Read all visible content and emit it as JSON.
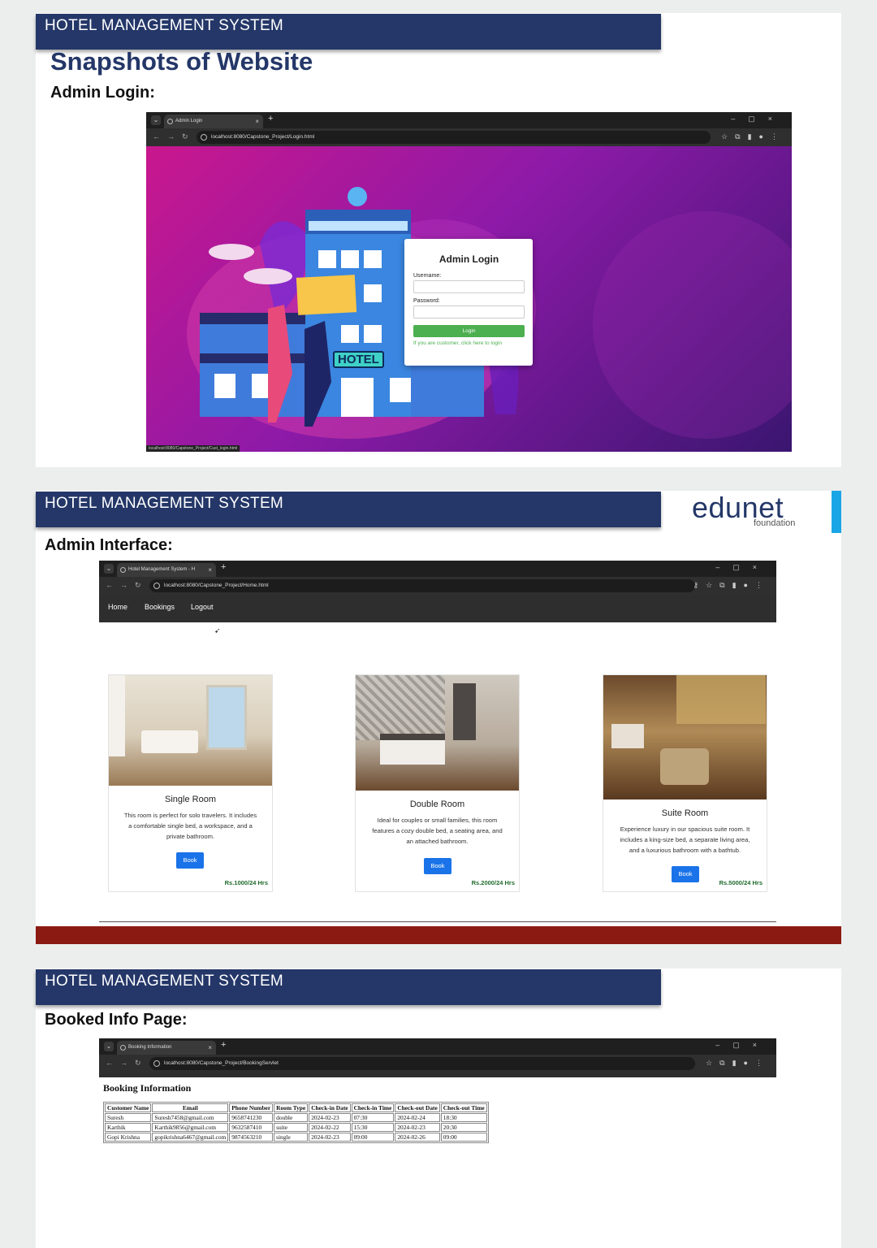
{
  "slide1": {
    "banner": "HOTEL MANAGEMENT SYSTEM",
    "title": "Snapshots of Website",
    "subtitle": "Admin Login:",
    "browser": {
      "tab_title": "Admin Login",
      "url": "localhost:8080/Capstone_Project/Login.html",
      "status_url": "localhost:8080/Capstone_Project/Cust_login.html"
    },
    "hotel_sign": "HOTEL",
    "login": {
      "title": "Admin Login",
      "username_label": "Username:",
      "password_label": "Password:",
      "button": "Login",
      "customer_link": "If you are customer, click here to login"
    }
  },
  "slide2": {
    "banner": "HOTEL MANAGEMENT SYSTEM",
    "logo_main": "edunet",
    "logo_sub": "foundation",
    "subtitle": "Admin Interface:",
    "browser": {
      "tab_title": "Hotel Management System - H",
      "url": "localhost:8080/Capstone_Project/Home.html"
    },
    "nav": [
      "Home",
      "Bookings",
      "Logout"
    ],
    "rooms": [
      {
        "name": "Single Room",
        "desc": "This room is perfect for solo travelers. It includes a comfortable single bed, a workspace, and a private bathroom.",
        "button": "Book",
        "price": "Rs.1000/24 Hrs"
      },
      {
        "name": "Double Room",
        "desc": "Ideal for couples or small families, this room features a cozy double bed, a seating area, and an attached bathroom.",
        "button": "Book",
        "price": "Rs.2000/24 Hrs"
      },
      {
        "name": "Suite Room",
        "desc": "Experience luxury in our spacious suite room. It includes a king-size bed, a separate living area, and a luxurious bathroom with a bathtub.",
        "button": "Book",
        "price": "Rs.5000/24 Hrs"
      }
    ]
  },
  "slide3": {
    "banner": "HOTEL MANAGEMENT SYSTEM",
    "subtitle": "Booked Info Page:",
    "browser": {
      "tab_title": "Booking Information",
      "url": "localhost:8080/Capstone_Project/BookingServlet"
    },
    "page_title": "Booking Information",
    "columns": [
      "Customer Name",
      "Email",
      "Phone Number",
      "Room Type",
      "Check-in Date",
      "Check-in Time",
      "Check-out Date",
      "Check-out Time"
    ],
    "rows": [
      [
        "Suresh",
        "Suresh7458@gmail.com",
        "9658741230",
        "double",
        "2024-02-23",
        "07:30",
        "2024-02-24",
        "18:30"
      ],
      [
        "Karthik",
        "Karthik9856@gmail.com",
        "9632587410",
        "suite",
        "2024-02-22",
        "15:30",
        "2024-02-23",
        "20:30"
      ],
      [
        "Gopi Krishna",
        "gopikrishna6467@gmail.com",
        "9874563210",
        "single",
        "2024-02-23",
        "09:00",
        "2024-02-26",
        "09:00"
      ]
    ]
  },
  "colors": {
    "banner": "#243768",
    "divider_red": "#8b1a12",
    "edunet_blue": "#243768",
    "edunet_red": "#b3261e",
    "login_green": "#4caf50",
    "book_blue": "#1a73e8"
  }
}
